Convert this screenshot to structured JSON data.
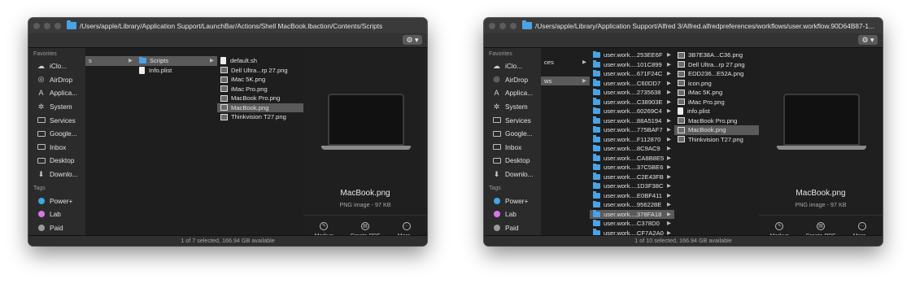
{
  "windowA": {
    "path": "/Users/apple/Library/Application Support/LaunchBar/Actions/Shell MacBook.lbaction/Contents/Scripts",
    "col1": [
      {
        "label": "s",
        "folder": false,
        "selected": true,
        "chevron": true
      }
    ],
    "col2": [
      {
        "label": "Scripts",
        "icon": "folder",
        "selected": true,
        "chevron": true
      },
      {
        "label": "Info.plist",
        "icon": "doc",
        "selected": false,
        "chevron": false
      }
    ],
    "col3": [
      {
        "label": "default.sh",
        "icon": "doc",
        "selected": false
      },
      {
        "label": "Dell Ultra...rp 27.png",
        "icon": "img",
        "selected": false
      },
      {
        "label": "iMac 5K.png",
        "icon": "img",
        "selected": false
      },
      {
        "label": "iMac Pro.png",
        "icon": "img",
        "selected": false
      },
      {
        "label": "MacBook Pro.png",
        "icon": "img",
        "selected": false
      },
      {
        "label": "MacBook.png",
        "icon": "img",
        "selected": true
      },
      {
        "label": "Thinkvision T27.png",
        "icon": "img",
        "selected": false
      }
    ],
    "preview_name": "MacBook.png",
    "preview_meta": "PNG image - 97 KB",
    "status": "1 of 7 selected, 166.94 GB available"
  },
  "windowB": {
    "path": "/Users/apple/Library/Application Support/Alfred 3/Alfred.alfredpreferences/workflows/user.workflow.90D64B87-1...",
    "col1": [
      {
        "label": "ces",
        "selected": false,
        "chevron": true
      },
      {
        "label": "ws",
        "selected": true,
        "chevron": true
      }
    ],
    "col2": [
      "user.work....253EE6F",
      "user.work....101C899",
      "user.work....671F24C",
      "user.work....C60DD7",
      "user.work....2735638",
      "user.work....C38903E",
      "user.work....60269C4",
      "user.work....88A5194",
      "user.work....775BAF7",
      "user.work....F112870",
      "user.work....8C9AC9",
      "user.work....CA8B8E5",
      "user.work....37C5BE6",
      "user.work....C2E43FB",
      "user.work....1D3F38C",
      "user.work....E0BF411",
      "user.work....956228E",
      "user.work....378FA18",
      "user.work....C378D0",
      "user.work....CF7A2A0"
    ],
    "col2_selected": 17,
    "col3": [
      {
        "label": "3B7E38A...C36.png",
        "icon": "img",
        "selected": false
      },
      {
        "label": "Dell Ultra...rp 27.png",
        "icon": "img",
        "selected": false
      },
      {
        "label": "EDD236...E52A.png",
        "icon": "img",
        "selected": false
      },
      {
        "label": "icon.png",
        "icon": "img",
        "selected": false
      },
      {
        "label": "iMac 5K.png",
        "icon": "img",
        "selected": false
      },
      {
        "label": "iMac Pro.png",
        "icon": "img",
        "selected": false
      },
      {
        "label": "info.plist",
        "icon": "doc",
        "selected": false
      },
      {
        "label": "MacBook Pro.png",
        "icon": "img",
        "selected": false
      },
      {
        "label": "MacBook.png",
        "icon": "img",
        "selected": true
      },
      {
        "label": "Thinkvision T27.png",
        "icon": "img",
        "selected": false
      }
    ],
    "preview_name": "MacBook.png",
    "preview_meta": "PNG image - 97 KB",
    "status": "1 of 10 selected, 166.94 GB available"
  },
  "sidebar": {
    "favorites_label": "Favorites",
    "favorites": [
      {
        "label": "iClo...",
        "icon": "cloud-icon",
        "glyph": "☁"
      },
      {
        "label": "AirDrop",
        "icon": "airdrop-icon",
        "glyph": "◎"
      },
      {
        "label": "Applica...",
        "icon": "applications-icon",
        "glyph": "A"
      },
      {
        "label": "System",
        "icon": "gear-icon",
        "glyph": "✲"
      },
      {
        "label": "Services",
        "icon": "folder-icon",
        "glyph": ""
      },
      {
        "label": "Google...",
        "icon": "folder-icon",
        "glyph": ""
      },
      {
        "label": "Inbox",
        "icon": "folder-icon",
        "glyph": ""
      },
      {
        "label": "Desktop",
        "icon": "desktop-icon",
        "glyph": ""
      },
      {
        "label": "Downlo...",
        "icon": "download-icon",
        "glyph": "⬇"
      }
    ],
    "tags_label": "Tags",
    "tags": [
      {
        "label": "Power+",
        "color": "#3fa7e0"
      },
      {
        "label": "Lab",
        "color": "#d678e8"
      },
      {
        "label": "Paid",
        "color": "#9a9a9a"
      }
    ]
  },
  "actions": [
    {
      "label": "Markup",
      "icon": "markup-icon",
      "glyph": "✎"
    },
    {
      "label": "Create PDF",
      "icon": "pdf-icon",
      "glyph": "▤"
    },
    {
      "label": "More...",
      "icon": "more-icon",
      "glyph": "···"
    }
  ],
  "gear_label": "⚙ ▾"
}
